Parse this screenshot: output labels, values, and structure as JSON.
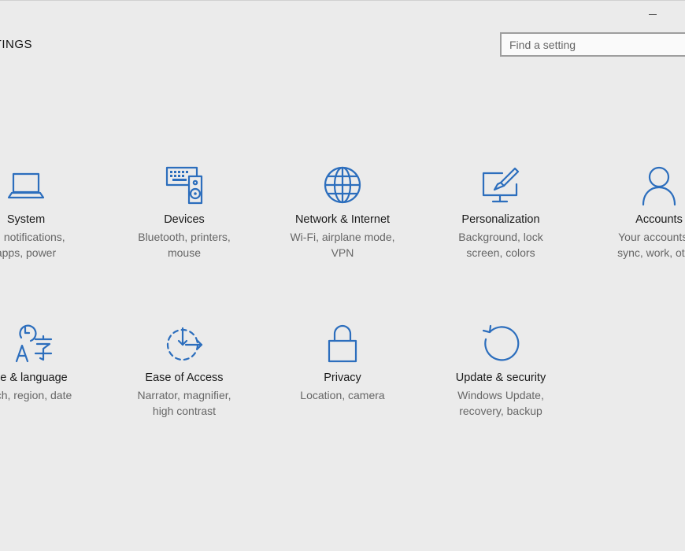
{
  "window": {
    "title": "TTINGS"
  },
  "search": {
    "placeholder": "Find a setting"
  },
  "tiles": [
    {
      "name": "System",
      "desc": "ay, notifications,\napps, power",
      "icon": "laptop-icon"
    },
    {
      "name": "Devices",
      "desc": "Bluetooth, printers,\nmouse",
      "icon": "devices-icon"
    },
    {
      "name": "Network & Internet",
      "desc": "Wi-Fi, airplane mode,\nVPN",
      "icon": "globe-icon"
    },
    {
      "name": "Personalization",
      "desc": "Background, lock\nscreen, colors",
      "icon": "paintbrush-icon"
    },
    {
      "name": "Accounts",
      "desc": "Your accounts, e\nsync, work, other",
      "icon": "person-icon"
    },
    {
      "name": "e & language",
      "desc": "ch, region, date",
      "icon": "time-language-icon"
    },
    {
      "name": "Ease of Access",
      "desc": "Narrator, magnifier,\nhigh contrast",
      "icon": "ease-of-access-icon"
    },
    {
      "name": "Privacy",
      "desc": "Location, camera",
      "icon": "lock-icon"
    },
    {
      "name": "Update & security",
      "desc": "Windows Update,\nrecovery, backup",
      "icon": "refresh-icon"
    }
  ],
  "colors": {
    "accent": "#2c6ebd",
    "background": "#ebebeb"
  }
}
